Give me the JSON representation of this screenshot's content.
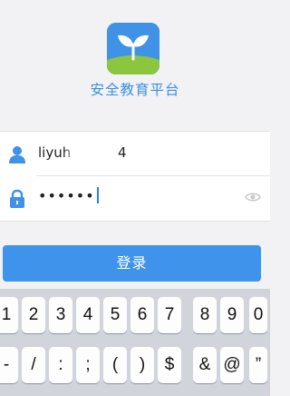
{
  "app": {
    "title": "安全教育平台",
    "accent": "#3f92e6"
  },
  "form": {
    "username_prefix": "liyuh",
    "username_suffix": "4",
    "password_mask": "••••••"
  },
  "login_button": {
    "label": "登录"
  },
  "keyboard": {
    "row1": [
      "1",
      "2",
      "3",
      "4",
      "5",
      "6",
      "7",
      "8",
      "9",
      "0"
    ],
    "row2": [
      "-",
      "/",
      ":",
      ";",
      "(",
      ")",
      "$",
      "&",
      "@",
      "”"
    ]
  }
}
